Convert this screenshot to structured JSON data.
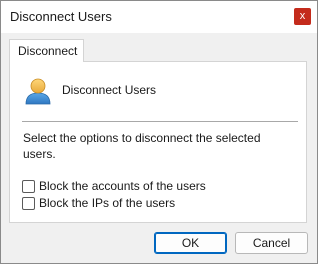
{
  "window": {
    "title": "Disconnect Users",
    "close_glyph": "x"
  },
  "tabs": [
    {
      "label": "Disconnect",
      "selected": true
    }
  ],
  "panel": {
    "icon": "user-icon",
    "heading": "Disconnect Users",
    "instructions": "Select the options to disconnect the selected users.",
    "options": [
      {
        "label": "Block the accounts of the users",
        "checked": false
      },
      {
        "label": "Block the IPs of the users",
        "checked": false
      }
    ]
  },
  "buttons": {
    "ok_label": "OK",
    "cancel_label": "Cancel"
  },
  "colors": {
    "close_button": "#c42b1c",
    "default_button_border": "#0067c0",
    "window_background": "#f0f0f0",
    "panel_background": "#ffffff"
  }
}
